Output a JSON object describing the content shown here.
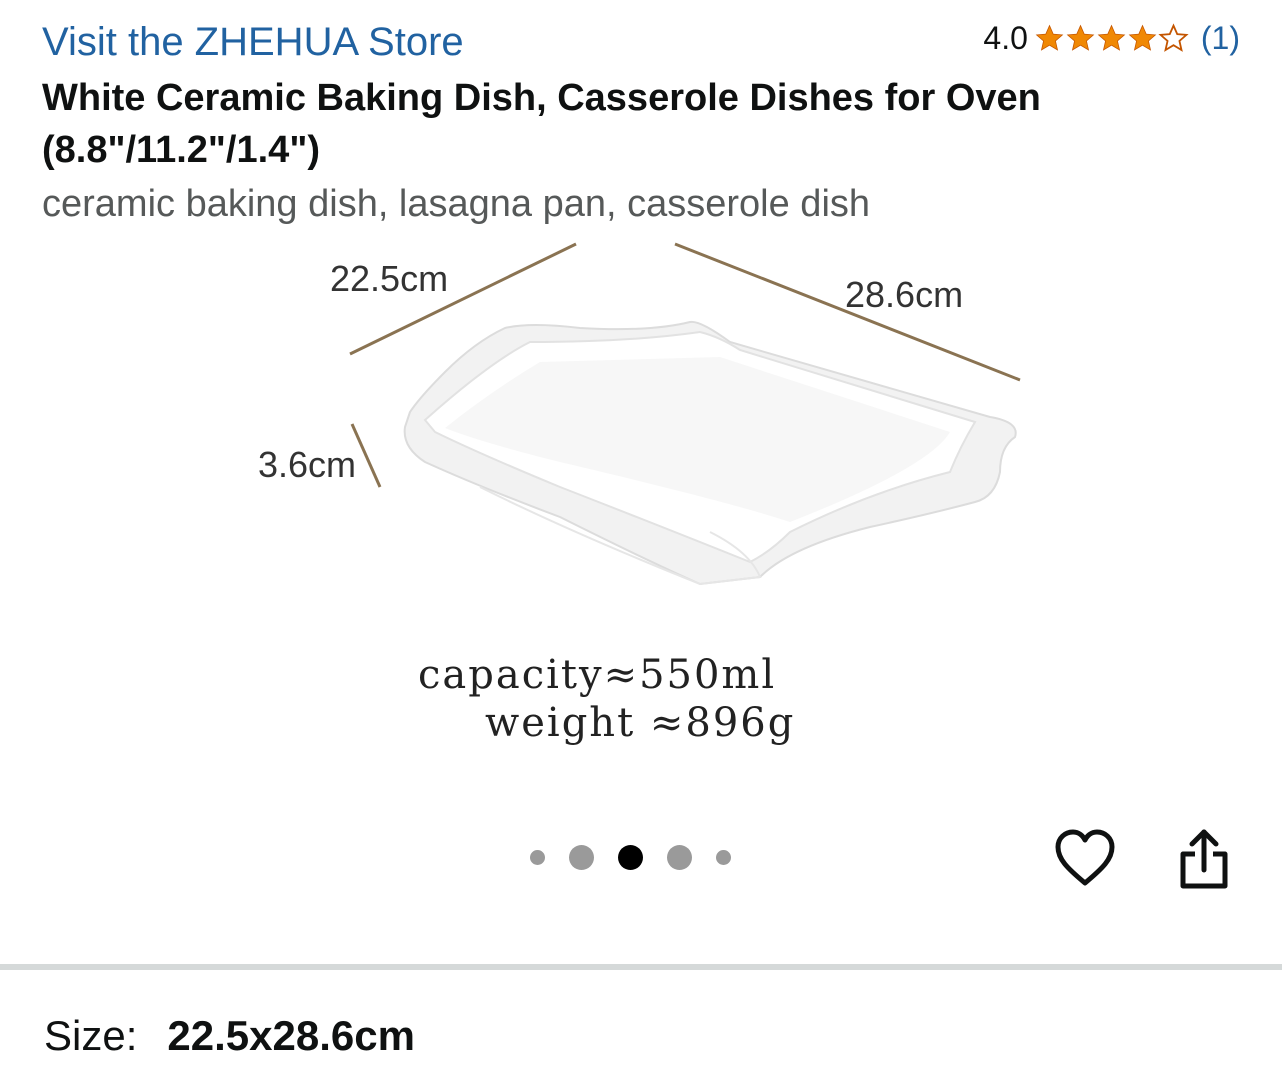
{
  "store": {
    "link_text": "Visit the ZHEHUA Store"
  },
  "rating": {
    "value": "4.0",
    "stars": 4,
    "max_stars": 5,
    "count": "(1)",
    "star_color": "#f08804"
  },
  "product": {
    "title": "White Ceramic Baking Dish, Casserole Dishes for Oven (8.8\"/11.2\"/1.4\")",
    "subtitle": "ceramic baking dish, lasagna pan, casserole dish"
  },
  "image": {
    "dim_width": "22.5cm",
    "dim_length": "28.6cm",
    "dim_height": "3.6cm",
    "capacity": "capacity≈550ml",
    "weight": "weight ≈896g"
  },
  "carousel": {
    "total": 5,
    "active_index": 2
  },
  "actions": {
    "wishlist_icon": "heart-icon",
    "share_icon": "share-icon"
  },
  "size": {
    "label": "Size:",
    "value": "22.5x28.6cm"
  },
  "colors": {
    "link": "#2162a1",
    "secondary_text": "#565959",
    "divider": "#d5d9d9"
  }
}
